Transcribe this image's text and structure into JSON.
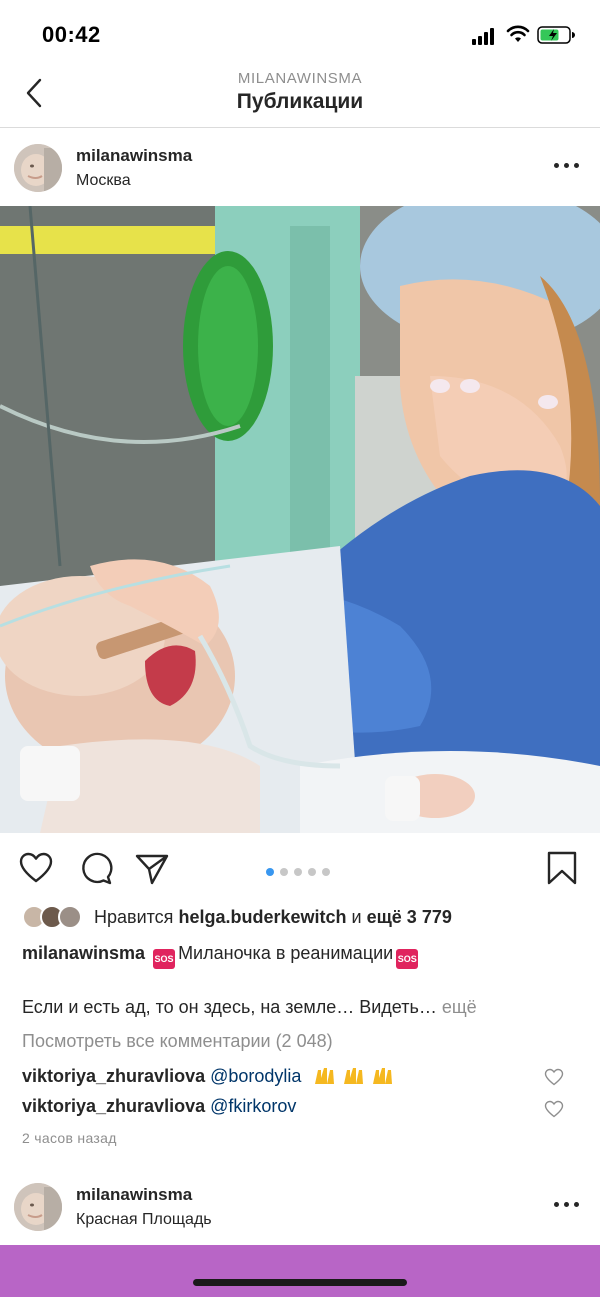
{
  "status_bar": {
    "time": "00:42",
    "icons": [
      "signal-icon",
      "wifi-icon",
      "battery-icon"
    ],
    "battery_color": "#34c759"
  },
  "nav": {
    "subtitle": "MILANAWINSMA",
    "title": "Публикации",
    "back_icon": "chevron-left-icon"
  },
  "post": {
    "username": "milanawinsma",
    "location": "Москва",
    "photo_description_icon": "photo",
    "carousel": {
      "count": 5,
      "active": 0,
      "active_color": "#3897f0"
    },
    "likes": {
      "prefix": "Нравится",
      "user": "helga.buderkewitch",
      "conj": "и",
      "others": "ещё 3 779"
    },
    "caption": {
      "username": "milanawinsma",
      "text": "Миланочка в реанимации",
      "badge": "SOS",
      "continued": "Если и есть ад, то он здесь, на земле… Видеть…",
      "more_label": "ещё"
    },
    "view_comments": "Посмотреть все комментарии (2 048)",
    "comments": [
      {
        "user": "viktoriya_zhuravliova",
        "mention": "@borodylia",
        "emoji": "raised-hands-x3"
      },
      {
        "user": "viktoriya_zhuravliova",
        "mention": "@fkirkorov",
        "emoji": ""
      }
    ],
    "timestamp": "2 часов назад"
  },
  "next_post": {
    "username": "milanawinsma",
    "location": "Красная Площадь"
  },
  "colors": {
    "text": "#262626",
    "muted": "#8e8e8e",
    "mention": "#003569",
    "bottom_bar": "#b865c6"
  }
}
